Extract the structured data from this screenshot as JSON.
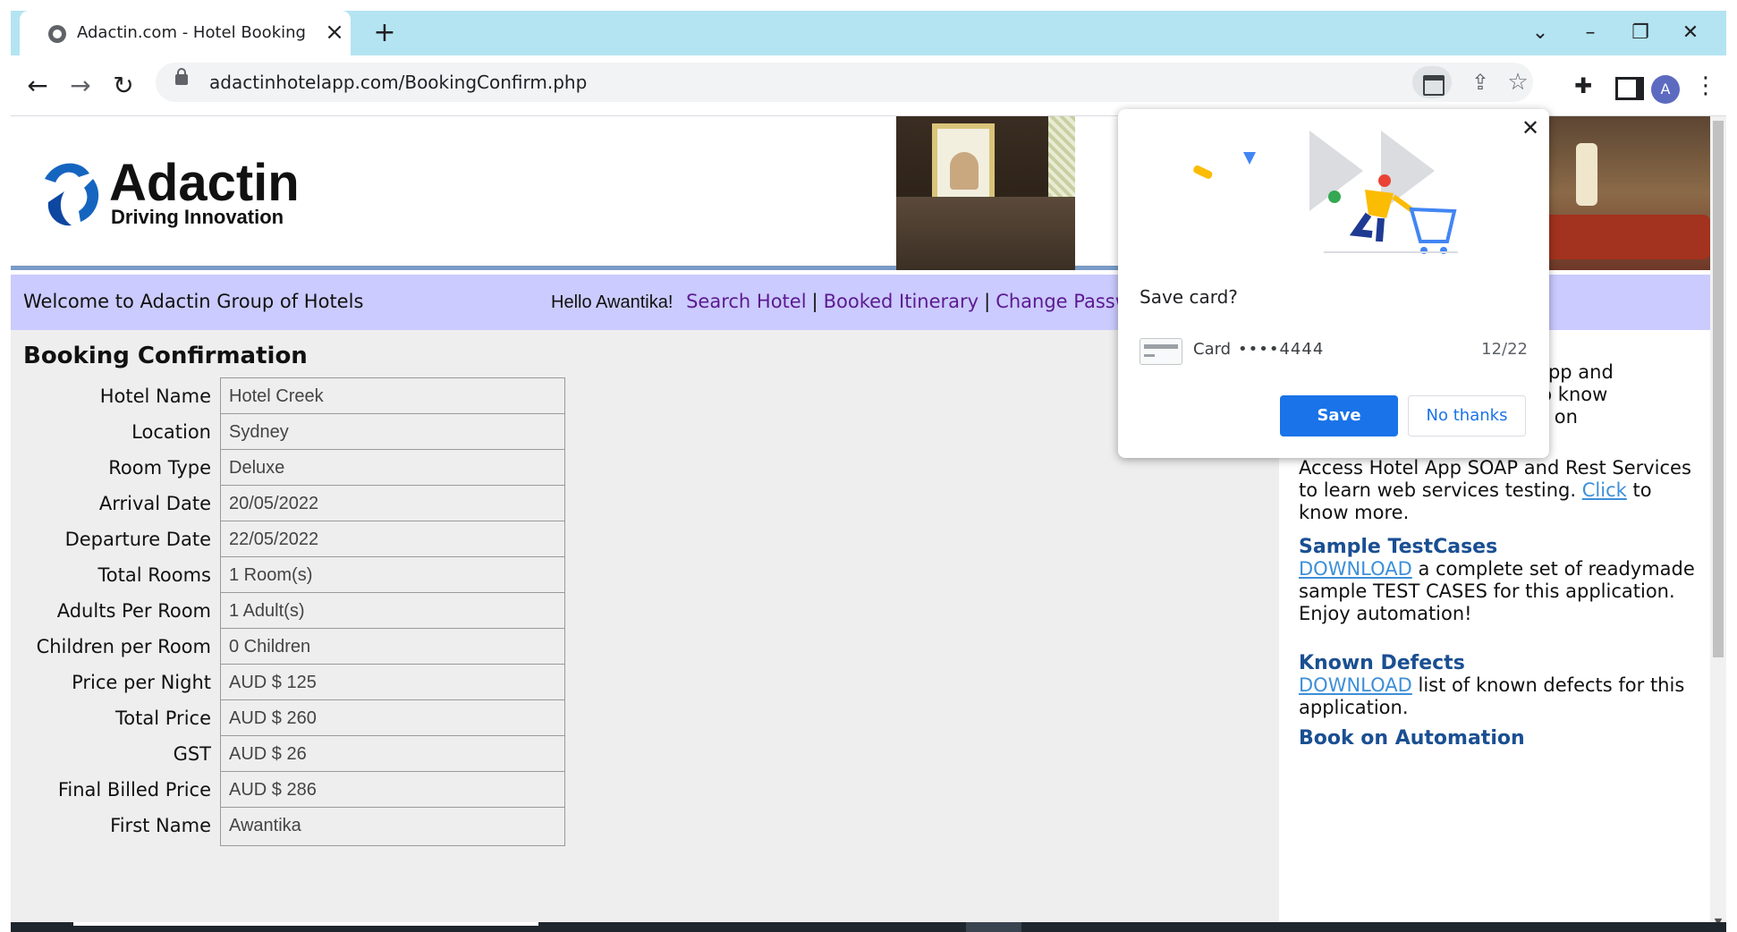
{
  "browser": {
    "tab_title": "Adactin.com - Hotel Booking Confirmation",
    "new_tab_label": "+",
    "url": "adactinhotelapp.com/BookingConfirm.php",
    "profile_initial": "A"
  },
  "header": {
    "logo_title": "Adactin",
    "logo_tagline": "Driving Innovation"
  },
  "welcome_bar": {
    "welcome_text": "Welcome to Adactin Group of Hotels",
    "hello": "Hello Awantika!",
    "links": [
      "Search Hotel",
      "Booked Itinerary",
      "Change Password"
    ],
    "separator": "|"
  },
  "booking": {
    "heading": "Booking Confirmation",
    "fields": [
      {
        "label": "Hotel Name",
        "value": "Hotel Creek"
      },
      {
        "label": "Location",
        "value": "Sydney"
      },
      {
        "label": "Room Type",
        "value": "Deluxe"
      },
      {
        "label": "Arrival Date",
        "value": "20/05/2022"
      },
      {
        "label": "Departure Date",
        "value": "22/05/2022"
      },
      {
        "label": "Total Rooms",
        "value": "1 Room(s)"
      },
      {
        "label": "Adults Per Room",
        "value": "1 Adult(s)"
      },
      {
        "label": "Children per Room",
        "value": "0 Children"
      },
      {
        "label": "Price per Night",
        "value": "AUD $ 125"
      },
      {
        "label": "Total Price",
        "value": "AUD $ 260"
      },
      {
        "label": "GST",
        "value": "AUD $ 26"
      },
      {
        "label": "Final Billed Price",
        "value": "AUD $ 286"
      },
      {
        "label": "First Name",
        "value": "Awantika"
      }
    ]
  },
  "sidebar": {
    "mobile_title_fragment": "p",
    "mobile_lines": [
      "bile App and",
      "lick to know",
      "e app on"
    ],
    "api_text_before": "Access Hotel App SOAP and Rest Services to learn web services testing.",
    "api_link": "Click",
    "api_text_after": "to know more.",
    "testcases_title": "Sample TestCases",
    "testcases_link": "DOWNLOAD",
    "testcases_text": "a complete set of readymade sample TEST CASES for this application. Enjoy automation!",
    "defects_title": "Known Defects",
    "defects_link": "DOWNLOAD",
    "defects_text": "list of known defects for this application.",
    "book_title": "Book on Automation"
  },
  "save_card_popup": {
    "title": "Save card?",
    "card_label": "Card",
    "card_number": "••••4444",
    "expiry": "12/22",
    "save_label": "Save",
    "no_thanks_label": "No thanks"
  },
  "icons": [
    "globe-icon",
    "close-icon",
    "chevron-down-icon",
    "minimize-icon",
    "restore-icon",
    "back-icon",
    "forward-icon",
    "reload-icon",
    "lock-icon",
    "card-icon",
    "share-icon",
    "star-icon",
    "extensions-icon",
    "side-panel-icon",
    "menu-icon"
  ],
  "colors": {
    "tab_strip": "#b4e4f2",
    "welcome_bar": "#cbcbff",
    "link_purple": "#5c1a91",
    "sidebar_title": "#1a4f92",
    "save_button": "#1a73e8"
  }
}
